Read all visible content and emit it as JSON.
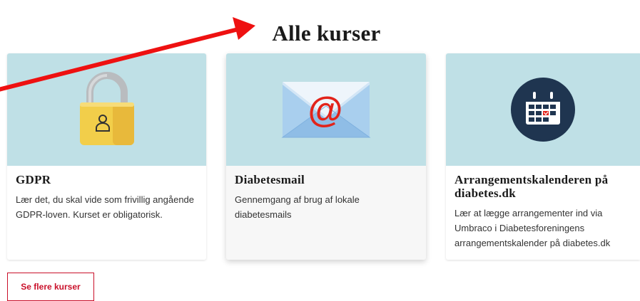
{
  "page": {
    "title": "Alle kurser"
  },
  "courses": [
    {
      "title": "GDPR",
      "description": "Lær det, du skal vide som frivillig angående GDPR-loven. Kurset er obligatorisk.",
      "icon": "padlock-icon"
    },
    {
      "title": "Diabetesmail",
      "description": "Gennemgang af brug af lokale diabetesmails",
      "icon": "envelope-icon"
    },
    {
      "title": "Arrangementskalenderen på diabetes.dk",
      "description": "Lær at lægge arrangementer ind via Umbraco i Diabetesforeningens arrangementskalender på diabetes.dk",
      "icon": "calendar-icon"
    }
  ],
  "more_button": {
    "label": "Se flere kurser"
  },
  "colors": {
    "accent": "#c9102a",
    "card_image_bg": "#bfe0e6",
    "annotation_arrow": "#ee1111"
  }
}
